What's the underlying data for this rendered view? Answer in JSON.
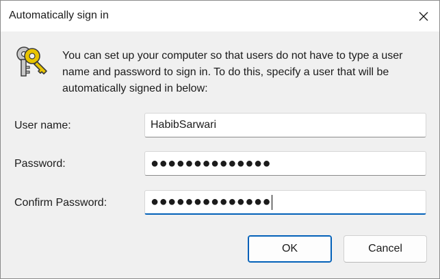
{
  "dialog": {
    "title": "Automatically sign in",
    "close_icon": "close-icon",
    "keys_icon": "keys-icon",
    "description": "You can set up your computer so that users do not have to type a user name and password to sign in. To do this, specify a user that will be automatically signed in below:"
  },
  "fields": {
    "username_label": "User name:",
    "username_value": "HabibSarwari",
    "password_label": "Password:",
    "password_value": "●●●●●●●●●●●●●●",
    "confirm_label": "Confirm Password:",
    "confirm_value": "●●●●●●●●●●●●●●"
  },
  "buttons": {
    "ok_label": "OK",
    "cancel_label": "Cancel"
  },
  "colors": {
    "accent": "#005fb8",
    "key_gold": "#e8c400",
    "key_silver": "#b8b8b8"
  }
}
